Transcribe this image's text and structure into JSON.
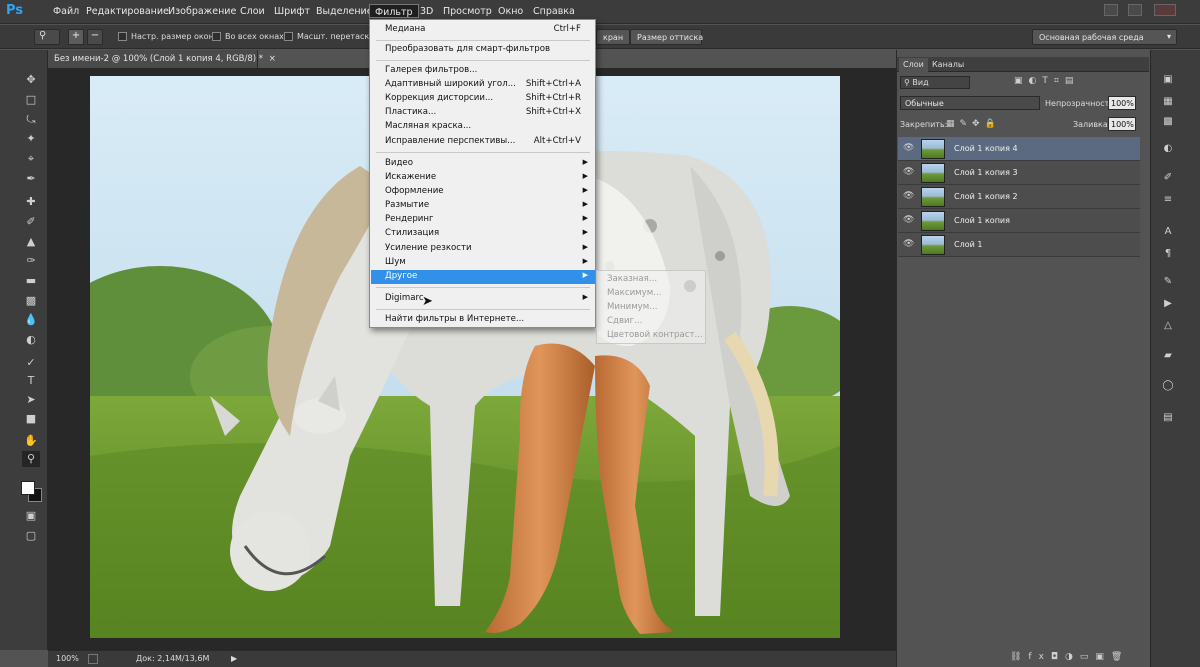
{
  "app": {
    "logo_text": "Ps"
  },
  "menubar": {
    "items": [
      "Файл",
      "Редактирование",
      "Изображение",
      "Слои",
      "Шрифт",
      "Выделение",
      "Фильтр",
      "3D",
      "Просмотр",
      "Окно",
      "Справка"
    ],
    "active": "Фильтр"
  },
  "options": {
    "resize_windows": "Настр. размер окон",
    "all_windows": "Во всех окнах",
    "scrubby_zoom": "Масшт. перетаскиванием",
    "fill_screen": "кран",
    "print_size": "Размер оттиска"
  },
  "workspace": {
    "label": "Основная рабочая среда"
  },
  "document": {
    "tab_title": "Без имени-2 @ 100% (Слой 1 копия 4, RGB/8) *"
  },
  "status": {
    "zoom": "100%",
    "doc_size": "Док: 2,14M/13,6M"
  },
  "filter_menu": {
    "items": [
      {
        "label": "Медиана",
        "shortcut": "Ctrl+F"
      },
      {
        "label": "Преобразовать для смарт-фильтров"
      },
      {
        "label": "Галерея фильтров..."
      },
      {
        "label": "Адаптивный широкий угол...",
        "shortcut": "Shift+Ctrl+A"
      },
      {
        "label": "Коррекция дисторсии...",
        "shortcut": "Shift+Ctrl+R"
      },
      {
        "label": "Пластика...",
        "shortcut": "Shift+Ctrl+X"
      },
      {
        "label": "Масляная краска..."
      },
      {
        "label": "Исправление перспективы...",
        "shortcut": "Alt+Ctrl+V"
      },
      {
        "label": "Видео",
        "submenu": true
      },
      {
        "label": "Искажение",
        "submenu": true
      },
      {
        "label": "Оформление",
        "submenu": true
      },
      {
        "label": "Размытие",
        "submenu": true
      },
      {
        "label": "Рендеринг",
        "submenu": true
      },
      {
        "label": "Стилизация",
        "submenu": true
      },
      {
        "label": "Усиление резкости",
        "submenu": true
      },
      {
        "label": "Шум",
        "submenu": true
      },
      {
        "label": "Другое",
        "submenu": true,
        "highlighted": true
      },
      {
        "label": "Digimarc",
        "submenu": true
      },
      {
        "label": "Найти фильтры в Интернете..."
      }
    ]
  },
  "other_submenu": {
    "items": [
      "Заказная...",
      "Максимум...",
      "Минимум...",
      "Сдвиг...",
      "Цветовой контраст..."
    ]
  },
  "layers_panel": {
    "tabs": [
      "Слои",
      "Каналы"
    ],
    "kind_filter": "Вид",
    "blend_mode": "Обычные",
    "opacity_label": "Непрозрачность:",
    "opacity_value": "100%",
    "lock_label": "Закрепить:",
    "fill_label": "Заливка:",
    "fill_value": "100%",
    "layers": [
      {
        "name": "Слой 1 копия 4",
        "selected": true
      },
      {
        "name": "Слой 1 копия 3"
      },
      {
        "name": "Слой 1 копия 2"
      },
      {
        "name": "Слой 1 копия"
      },
      {
        "name": "Слой 1"
      }
    ]
  },
  "icons": {
    "tools": [
      "move-icon",
      "marquee-icon",
      "lasso-icon",
      "quick-select-icon",
      "crop-icon",
      "eyedropper-icon",
      "healing-icon",
      "brush-icon",
      "stamp-icon",
      "history-brush-icon",
      "eraser-icon",
      "gradient-icon",
      "blur-icon",
      "dodge-icon",
      "pen-icon",
      "type-icon",
      "path-select-icon",
      "shape-icon",
      "hand-icon",
      "zoom-icon"
    ]
  },
  "colors": {
    "menu_highlight": "#3390e8",
    "selected_layer": "#5b6a80",
    "ps_blue": "#2fa3f6"
  }
}
